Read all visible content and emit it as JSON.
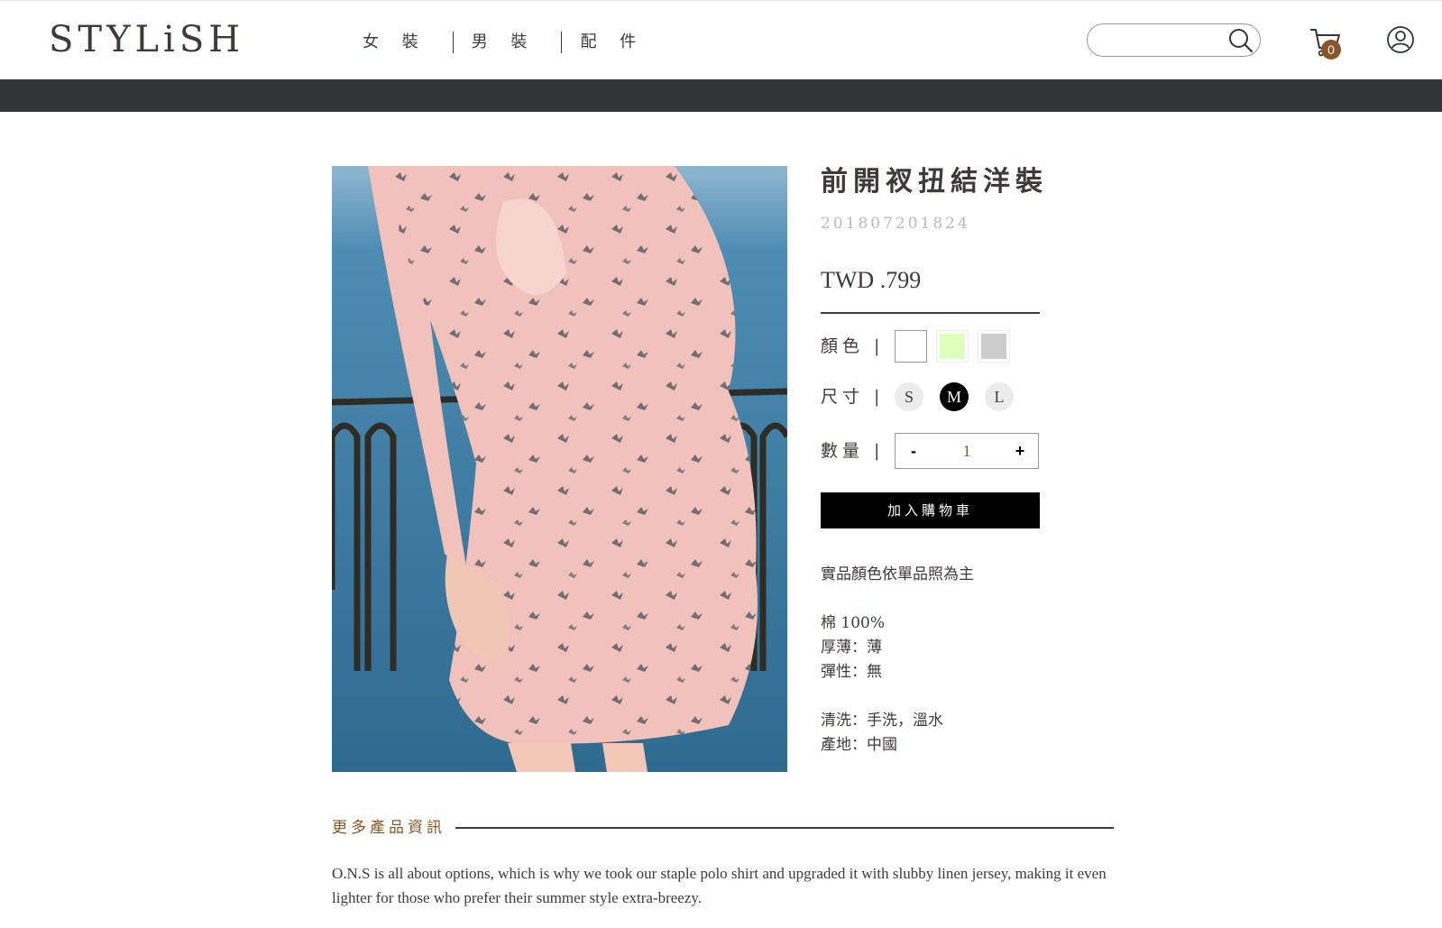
{
  "header": {
    "logo": "STYLiSH",
    "nav": [
      "女 裝",
      "男 裝",
      "配 件"
    ],
    "search_value": "",
    "cart_count": "0"
  },
  "product": {
    "title": "前開衩扭結洋裝",
    "id": "201807201824",
    "price": "TWD .799",
    "color_label": "顏色 |",
    "colors": [
      "#ffffff",
      "#ddffbb",
      "#cccccc"
    ],
    "size_label": "尺寸 |",
    "sizes": [
      "S",
      "M",
      "L"
    ],
    "selected_size": "M",
    "quantity_label": "數量 |",
    "quantity": "1",
    "minus": "-",
    "plus": "+",
    "add_to_cart": "加入購物車",
    "note": "實品顏色依單品照為主",
    "texture": "棉 100%",
    "thickness": "厚薄：薄",
    "elasticity": "彈性：無",
    "wash": "清洗：手洗，溫水",
    "place": "產地：中國"
  },
  "more": {
    "title": "更多產品資訊",
    "story": "O.N.S is all about options, which is why we took our staple polo shirt and upgraded it with slubby linen jersey, making it even lighter for those who prefer their summer style extra-breezy."
  },
  "colors": {
    "brand_brown": "#8b572a",
    "dark_bar": "#313538",
    "text": "#3f3a3a"
  },
  "icons": [
    "search-icon",
    "cart-icon",
    "member-icon"
  ]
}
